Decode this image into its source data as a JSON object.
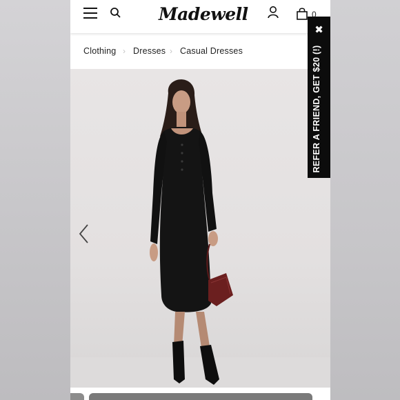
{
  "header": {
    "logo": "Madewell",
    "bag_count": "0",
    "icons": [
      "hamburger-menu-icon",
      "search-icon",
      "account-icon",
      "shopping-bag-icon"
    ]
  },
  "breadcrumb": {
    "items": [
      "Clothing",
      "Dresses",
      "Casual Dresses"
    ]
  },
  "promo_tab": {
    "label": "REFER A FRIEND, GET $20 (!)",
    "close_glyph": "✖"
  },
  "colors": {
    "promo_background": "#0c0c0c",
    "dress": "#141414",
    "handbag": "#6b1f1f"
  }
}
